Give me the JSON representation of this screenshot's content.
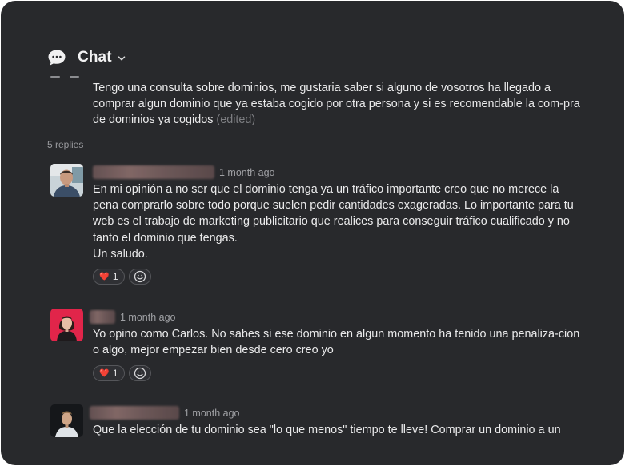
{
  "header": {
    "title": "Chat",
    "icon": "speech-bubble-icon",
    "dropdown_icon": "chevron-down-icon"
  },
  "original_post": {
    "text": "Tengo una consulta sobre dominios, me gustaria saber si alguno de vosotros ha llegado a comprar algun dominio que ya estaba cogido por otra persona y si es recomendable la com-pra de dominios ya cogidos",
    "edited_label": "(edited)"
  },
  "replies": {
    "count_label": "5 replies",
    "items": [
      {
        "time": "1 month ago",
        "text": "En mi opinión a no ser que el dominio tenga ya un tráfico importante creo que no merece la pena comprarlo sobre todo porque suelen pedir cantidades exageradas. Lo importante para tu web es el trabajo de marketing publicitario que realices para conseguir tráfico cualificado y no tanto el dominio que tengas.",
        "text2": "Un saludo.",
        "reaction": {
          "emoji": "❤️",
          "count": "1"
        }
      },
      {
        "time": "1 month ago",
        "text": "Yo opino como Carlos. No sabes si ese dominio en algun momento ha tenido una penaliza-cion o algo, mejor empezar bien desde cero creo yo",
        "reaction": {
          "emoji": "❤️",
          "count": "1"
        }
      },
      {
        "time": "1 month ago",
        "text": "Que la elección de tu dominio sea \"lo que menos\" tiempo te lleve! Comprar un dominio a un"
      }
    ]
  },
  "colors": {
    "background": "#28292c",
    "text": "#eaeaeb",
    "muted": "#98999d"
  }
}
